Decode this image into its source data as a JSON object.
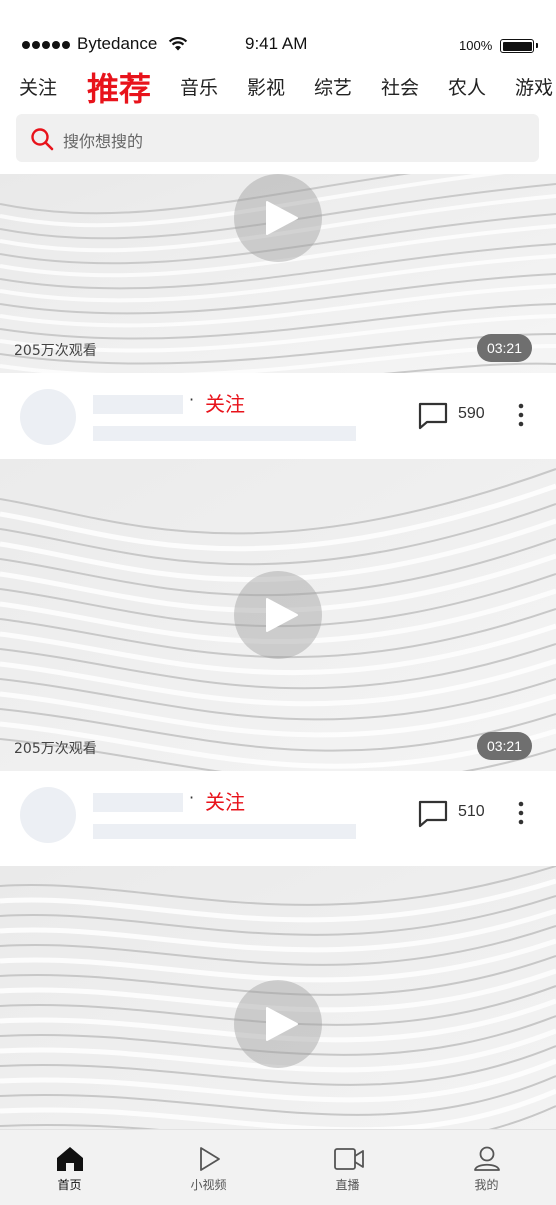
{
  "status_bar": {
    "carrier": "Bytedance",
    "time": "9:41 AM",
    "battery": "100%"
  },
  "tabs": [
    {
      "label": "关注",
      "active": false
    },
    {
      "label": "推荐",
      "active": true
    },
    {
      "label": "音乐",
      "active": false
    },
    {
      "label": "影视",
      "active": false
    },
    {
      "label": "综艺",
      "active": false
    },
    {
      "label": "社会",
      "active": false
    },
    {
      "label": "农人",
      "active": false
    },
    {
      "label": "游戏",
      "active": false
    }
  ],
  "search": {
    "placeholder": "搜你想搜的",
    "icon": "search-icon"
  },
  "feed": [
    {
      "views": "205万次观看",
      "duration": "03:21",
      "follow_label": "关注",
      "separator": "·",
      "comments": "590"
    },
    {
      "views": "205万次观看",
      "duration": "03:21",
      "follow_label": "关注",
      "separator": "·",
      "comments": "510"
    },
    {
      "views": "",
      "duration": ""
    }
  ],
  "bottom_nav": [
    {
      "label": "首页",
      "icon": "home-icon",
      "active": true
    },
    {
      "label": "小视频",
      "icon": "play-icon",
      "active": false
    },
    {
      "label": "直播",
      "icon": "video-camera-icon",
      "active": false
    },
    {
      "label": "我的",
      "icon": "user-icon",
      "active": false
    }
  ],
  "colors": {
    "accent": "#e8131b",
    "placeholder_block": "#eceff4",
    "nav_bg": "#f2f2f2"
  }
}
